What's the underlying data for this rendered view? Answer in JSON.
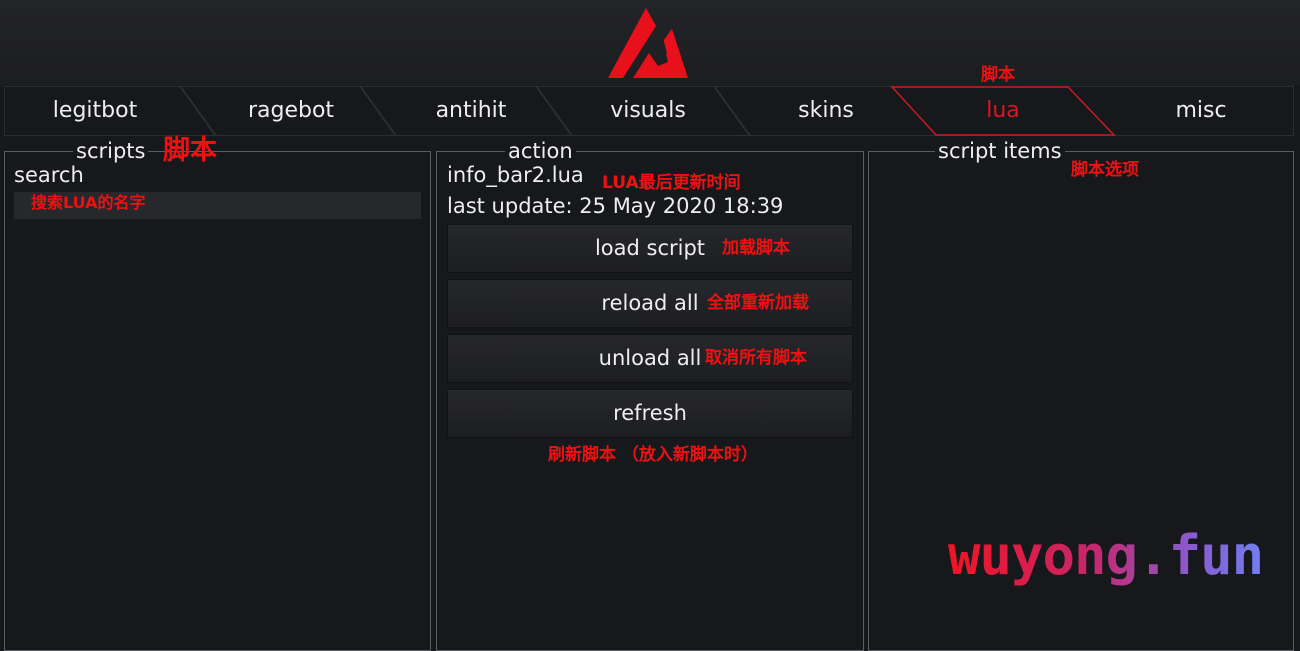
{
  "colors": {
    "accent": "#e0141f",
    "annotation": "#ee1111",
    "background": "#17181c"
  },
  "logo": {
    "icon": "triangle-logo-icon"
  },
  "tabs": [
    {
      "label": "legitbot"
    },
    {
      "label": "ragebot"
    },
    {
      "label": "antihit"
    },
    {
      "label": "visuals"
    },
    {
      "label": "skins"
    },
    {
      "label": "lua",
      "active": true,
      "note": "脚本"
    },
    {
      "label": "misc"
    }
  ],
  "scripts_panel": {
    "title": "scripts",
    "title_note": "脚本",
    "search_label": "search",
    "search_note": "搜索LUA的名字"
  },
  "action_panel": {
    "title": "action",
    "file_name": "info_bar2.lua",
    "file_note": "LUA最后更新时间",
    "last_update": "last update: 25 May 2020 18:39",
    "buttons": [
      {
        "label": "load script",
        "note": "加载脚本"
      },
      {
        "label": "reload all",
        "note": "全部重新加载"
      },
      {
        "label": "unload all",
        "note": "取消所有脚本"
      },
      {
        "label": "refresh",
        "note": ""
      }
    ],
    "refresh_note": "刷新脚本 （放入新脚本时）"
  },
  "items_panel": {
    "title": "script items",
    "note": "脚本选项"
  },
  "watermark": "wuyong.fun"
}
